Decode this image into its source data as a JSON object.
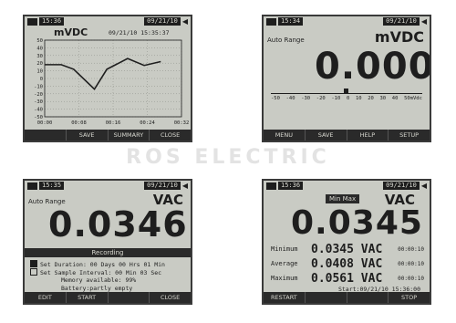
{
  "watermark": "ROS ELECTRIC",
  "panel1": {
    "time": "15:36",
    "date": "09/21/10",
    "unit": "mVDC",
    "timestamp": "09/21/10 15:35:37",
    "softkeys": [
      "",
      "SAVE",
      "SUMMARY",
      "CLOSE"
    ],
    "chart_data": {
      "type": "line",
      "x": [
        0,
        4,
        7,
        12,
        15,
        20,
        24,
        28
      ],
      "values": [
        18,
        18,
        12,
        -14,
        12,
        26,
        17,
        22
      ],
      "xlim": [
        0,
        33
      ],
      "ylim": [
        -50,
        50
      ],
      "y_ticks": [
        "50",
        "40",
        "30",
        "20",
        "10",
        "0",
        "-10",
        "-20",
        "-30",
        "-40",
        "-50"
      ],
      "x_ticks": [
        "00:00",
        "00:08",
        "00:16",
        "00:24",
        "00:32"
      ],
      "grid": true
    }
  },
  "panel2": {
    "time": "15:34",
    "date": "09/21/10",
    "mode": "Auto Range",
    "unit": "mVDC",
    "value": "0.0000",
    "scale_labels": [
      "-50",
      "-40",
      "-30",
      "-20",
      "-10",
      "0",
      "10",
      "20",
      "30",
      "40",
      "50mVdc"
    ],
    "softkeys": [
      "MENU",
      "SAVE",
      "HELP",
      "SETUP"
    ]
  },
  "panel3": {
    "time": "15:35",
    "date": "09/21/10",
    "mode": "Auto Range",
    "unit": "VAC",
    "value": "0.0346",
    "recording_title": "Recording",
    "duration_text": "Set Duration: 00 Days 00 Hrs 01 Min",
    "interval_text": "Set Sample Interval: 00 Min 03 Sec",
    "memory_text": "Memory available: 99%",
    "battery_text": "Battery:partly empty",
    "softkeys": [
      "EDIT",
      "START",
      "",
      "CLOSE"
    ]
  },
  "panel4": {
    "time": "15:36",
    "date": "09/21/10",
    "badge": "Min Max",
    "unit": "VAC",
    "value": "0.0345",
    "rows": [
      {
        "label": "Minimum",
        "value": "0.0345 VAC",
        "time": "00:00:10"
      },
      {
        "label": "Average",
        "value": "0.0408 VAC",
        "time": "00:00:10"
      },
      {
        "label": "Maximum",
        "value": "0.0561 VAC",
        "time": "00:00:10"
      }
    ],
    "start_text": "Start:09/21/10 15:36:00",
    "softkeys": [
      "RESTART",
      "",
      "",
      "STOP"
    ]
  }
}
